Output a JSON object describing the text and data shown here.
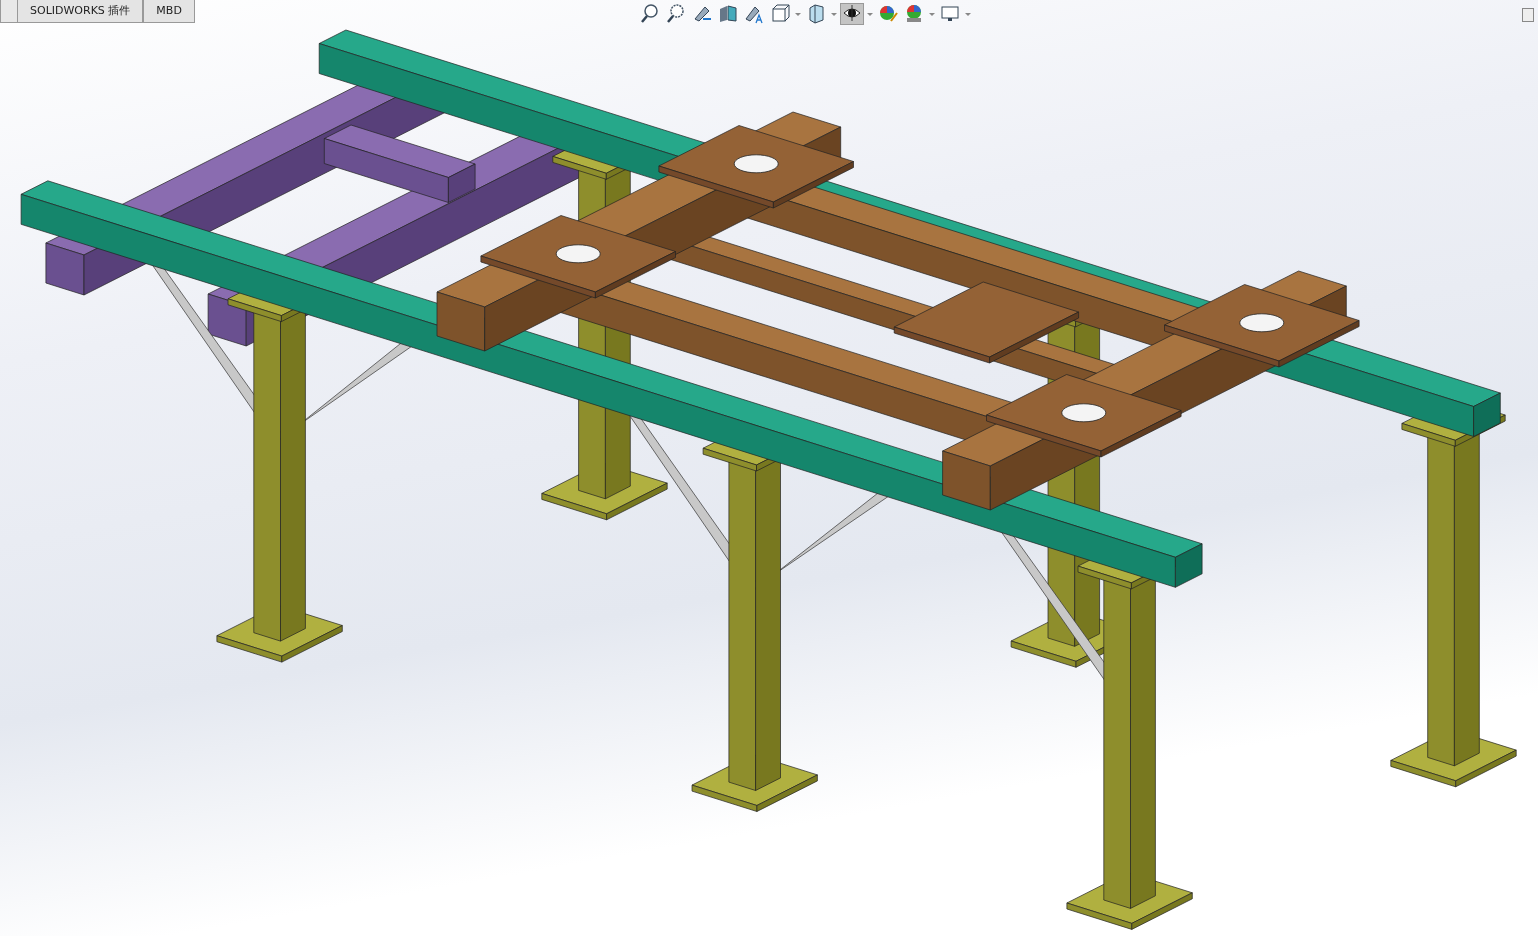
{
  "tabs": [
    {
      "label": "SOLIDWORKS 插件",
      "selected": false
    },
    {
      "label": "MBD",
      "selected": false
    }
  ],
  "toolbar": [
    {
      "has_menu": false,
      "selected": false
    },
    {
      "has_menu": false,
      "selected": false
    },
    {
      "has_menu": false,
      "selected": false
    },
    {
      "has_menu": false,
      "selected": false
    },
    {
      "has_menu": false,
      "selected": false
    },
    {
      "has_menu": true,
      "selected": false
    },
    {
      "has_menu": true,
      "selected": false
    },
    {
      "has_menu": true,
      "selected": true
    },
    {
      "has_menu": false,
      "selected": false
    },
    {
      "has_menu": true,
      "selected": false
    },
    {
      "has_menu": true,
      "selected": false
    }
  ]
}
